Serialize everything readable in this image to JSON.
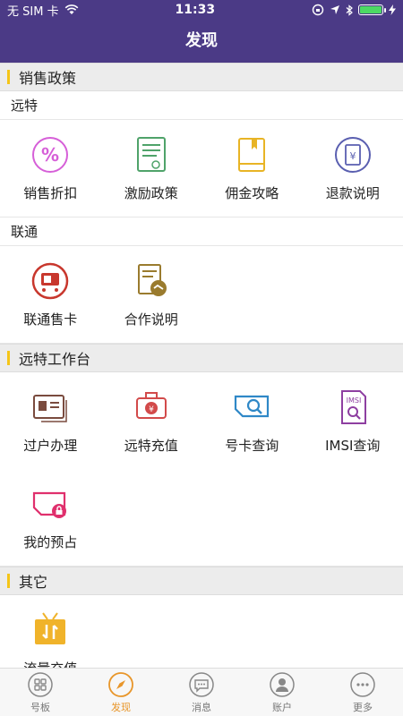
{
  "status": {
    "carrier": "无 SIM 卡",
    "time": "11:33"
  },
  "header": {
    "title": "发现"
  },
  "sections": [
    {
      "title": "销售政策"
    },
    {
      "title": "远特工作台"
    },
    {
      "title": "其它"
    }
  ],
  "subsections": {
    "yuante": "远特",
    "liantong": "联通"
  },
  "items": {
    "sales_discount": "销售折扣",
    "incentive_policy": "激励政策",
    "commission_guide": "佣金攻略",
    "refund_desc": "退款说明",
    "unicom_card": "联通售卡",
    "coop_desc": "合作说明",
    "transfer": "过户办理",
    "recharge": "远特充值",
    "card_query": "号卡查询",
    "imsi_query": "IMSI查询",
    "my_reserve": "我的预占",
    "traffic_recharge": "流量充值"
  },
  "tabs": [
    {
      "label": "号板"
    },
    {
      "label": "发现"
    },
    {
      "label": "消息"
    },
    {
      "label": "账户"
    },
    {
      "label": "更多"
    }
  ],
  "colors": {
    "header_bg": "#4b3a86",
    "accent": "#e8962a",
    "section_bar": "#f5c518"
  }
}
